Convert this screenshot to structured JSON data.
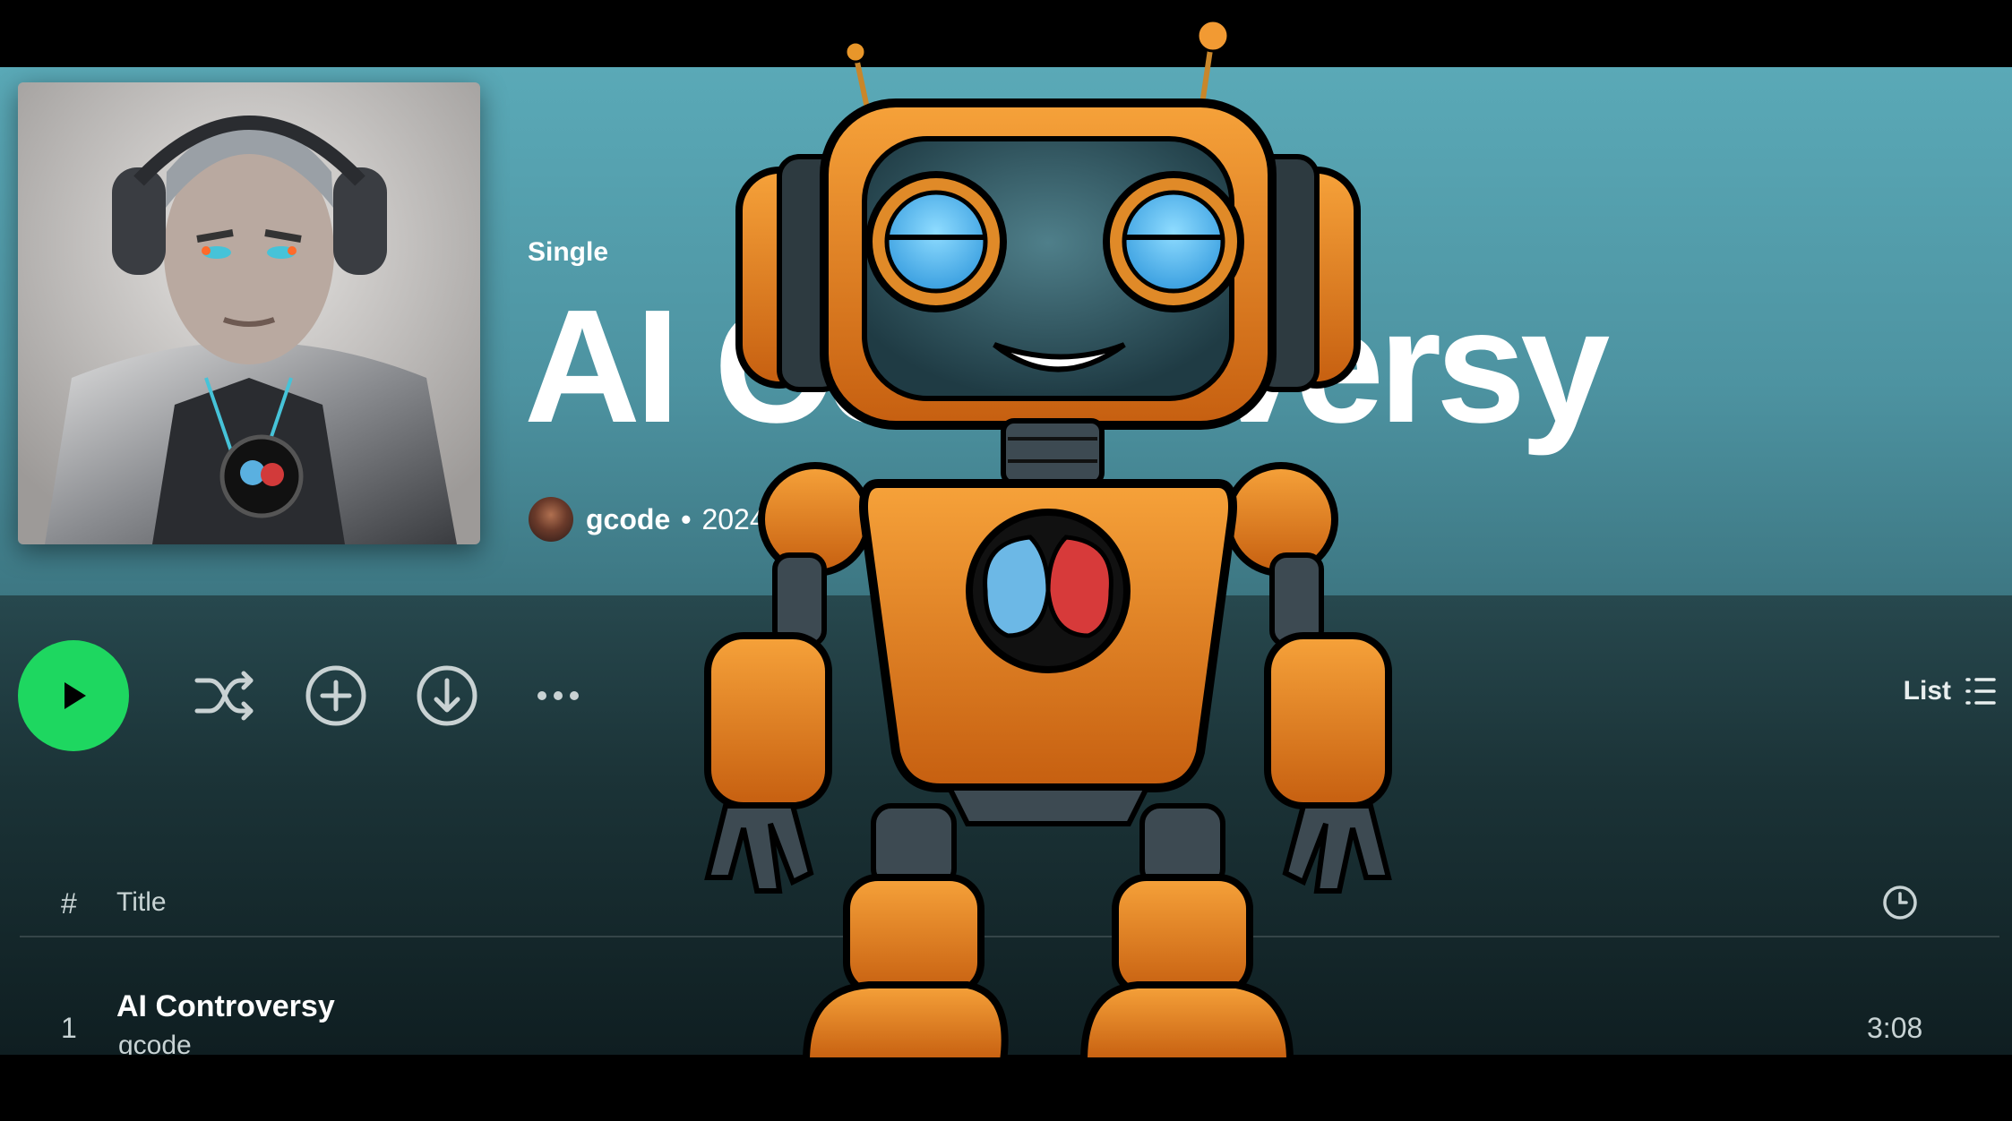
{
  "header": {
    "type_label": "Single",
    "title": "AI Controversy",
    "artist": "gcode",
    "year": "2024",
    "separator": "•"
  },
  "controls": {
    "play_icon": "play-icon",
    "shuffle_icon": "shuffle-icon",
    "add_icon": "add-circle-icon",
    "download_icon": "download-circle-icon",
    "more_icon": "more-icon",
    "view_label": "List",
    "view_icon": "list-icon",
    "accent_color": "#1ed760"
  },
  "tracklist": {
    "columns": {
      "number": "#",
      "title": "Title",
      "duration_icon": "clock-icon"
    },
    "tracks": [
      {
        "number": "1",
        "title": "AI Controversy",
        "artist": "gcode",
        "duration": "3:08"
      }
    ]
  }
}
